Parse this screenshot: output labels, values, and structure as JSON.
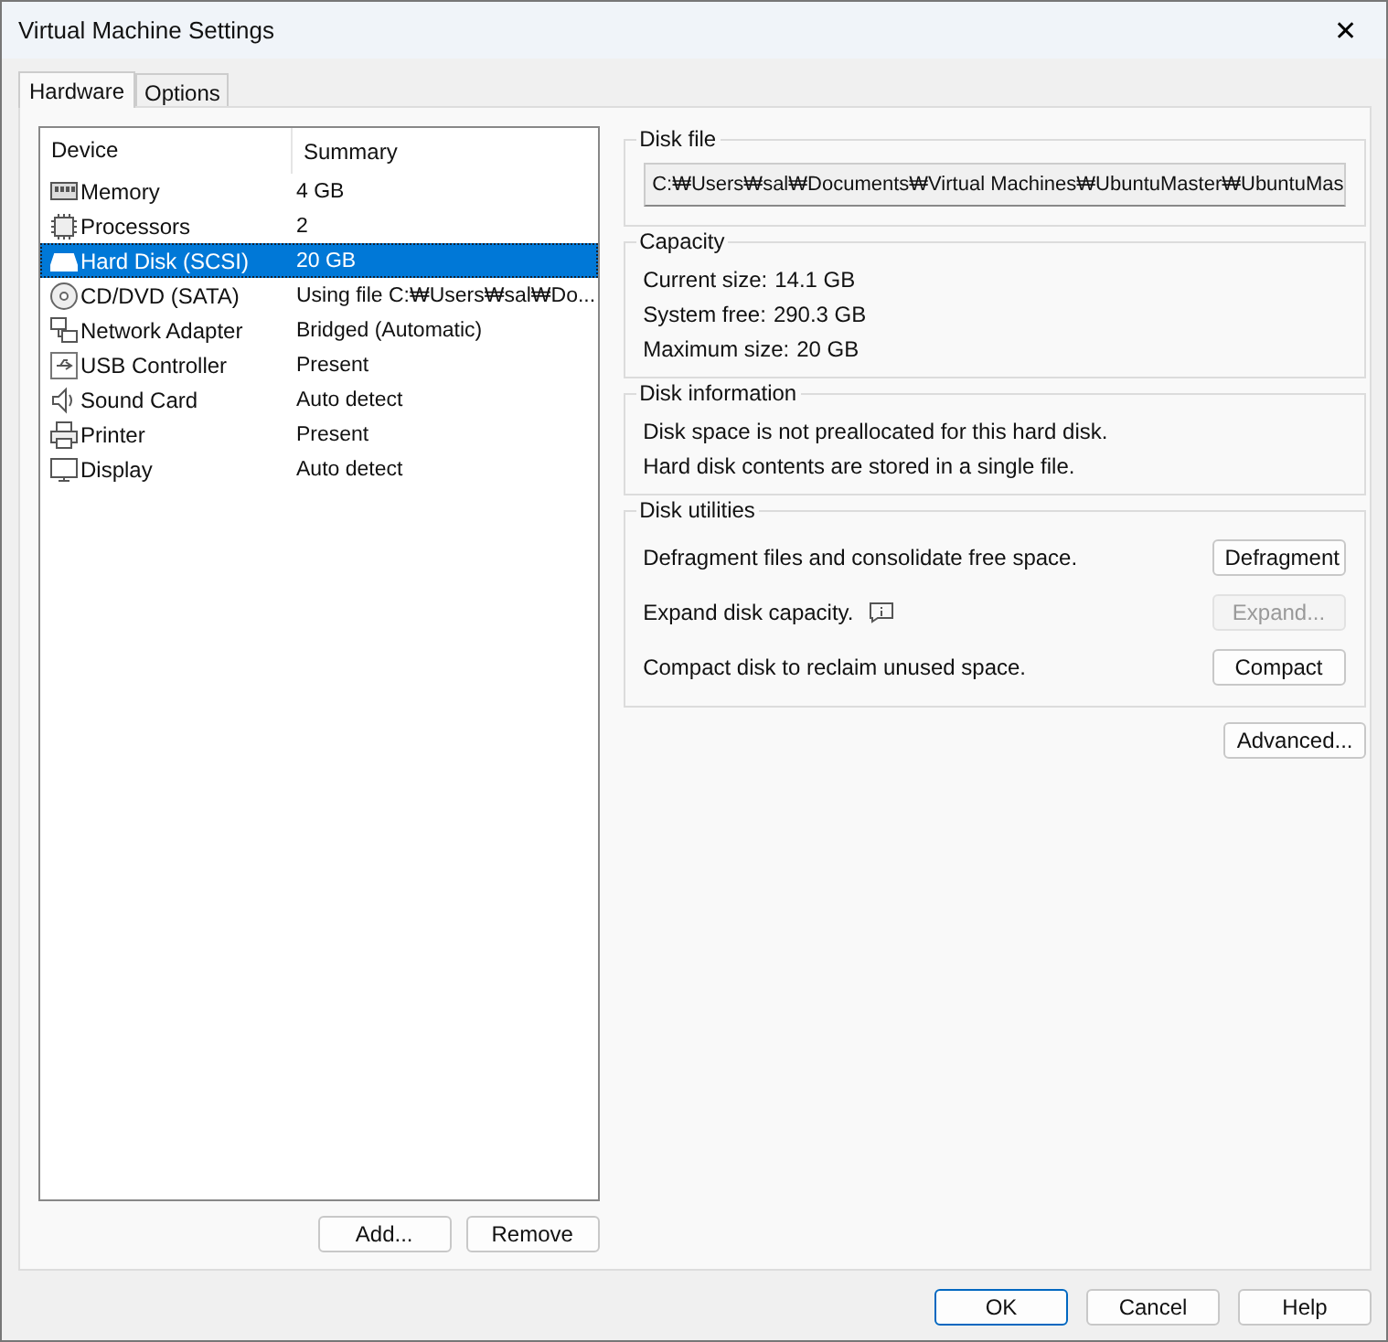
{
  "window": {
    "title": "Virtual Machine Settings",
    "close": "✕"
  },
  "tabs": [
    {
      "label": "Hardware",
      "selected": true
    },
    {
      "label": "Options",
      "selected": false
    }
  ],
  "device_list": {
    "columns": [
      "Device",
      "Summary"
    ],
    "rows": [
      {
        "kind": "memory",
        "device": "Memory",
        "summary": "4 GB",
        "selected": false
      },
      {
        "kind": "processor",
        "device": "Processors",
        "summary": "2",
        "selected": false
      },
      {
        "kind": "disk",
        "device": "Hard Disk (SCSI)",
        "summary": "20 GB",
        "selected": true
      },
      {
        "kind": "optical",
        "device": "CD/DVD (SATA)",
        "summary": "Using file C:₩Users₩sal₩Do...",
        "selected": false
      },
      {
        "kind": "network",
        "device": "Network Adapter",
        "summary": "Bridged (Automatic)",
        "selected": false
      },
      {
        "kind": "usb",
        "device": "USB Controller",
        "summary": "Present",
        "selected": false
      },
      {
        "kind": "sound",
        "device": "Sound Card",
        "summary": "Auto detect",
        "selected": false
      },
      {
        "kind": "printer",
        "device": "Printer",
        "summary": "Present",
        "selected": false
      },
      {
        "kind": "display",
        "device": "Display",
        "summary": "Auto detect",
        "selected": false
      }
    ],
    "buttons": [
      "Add...",
      "Remove"
    ]
  },
  "disk_file": {
    "title": "Disk file",
    "value": "C:₩Users₩sal₩Documents₩Virtual Machines₩UbuntuMaster₩UbuntuMas"
  },
  "capacity": {
    "title": "Capacity",
    "lines": [
      {
        "label": "Current size:",
        "value": "14.1 GB"
      },
      {
        "label": "System free:",
        "value": "290.3 GB"
      },
      {
        "label": "Maximum size:",
        "value": "20 GB"
      }
    ]
  },
  "disk_information": {
    "title": "Disk information",
    "lines": [
      "Disk space is not preallocated for this hard disk.",
      "Hard disk contents are stored in a single file."
    ]
  },
  "disk_utilities": {
    "title": "Disk utilities",
    "rows": [
      {
        "text": "Defragment files and consolidate free space.",
        "info_icon": false,
        "button": "Defragment",
        "disabled": false
      },
      {
        "text": "Expand disk capacity.",
        "info_icon": true,
        "button": "Expand...",
        "disabled": true
      },
      {
        "text": "Compact disk to reclaim unused space.",
        "info_icon": false,
        "button": "Compact",
        "disabled": false
      }
    ]
  },
  "advanced_button": "Advanced...",
  "footer_buttons": [
    {
      "label": "OK",
      "default": true
    },
    {
      "label": "Cancel",
      "default": false
    },
    {
      "label": "Help",
      "default": false
    }
  ]
}
